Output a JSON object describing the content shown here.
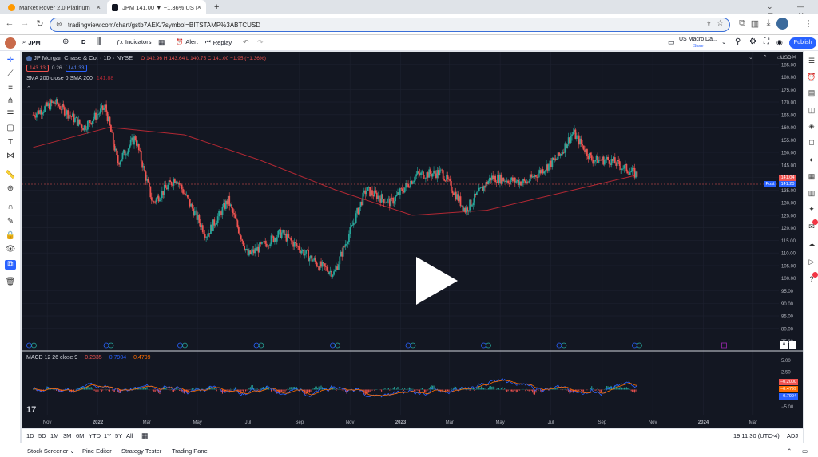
{
  "browser": {
    "tabs": [
      {
        "label": "Market Rover 2.0 Platinum"
      },
      {
        "label": "JPM 141.00 ▼ −1.36% US M..."
      }
    ],
    "url": "tradingview.com/chart/gstb7AEK/?symbol=BITSTAMP%3ABTCUSD"
  },
  "toolbar": {
    "symbol": "JPM",
    "interval": "D",
    "indicators_label": "Indicators",
    "alert_label": "Alert",
    "replay_label": "Replay",
    "layout_name": "US Macro Da...",
    "layout_status": "Save",
    "publish_label": "Publish"
  },
  "legend": {
    "title": "JP Morgan Chase & Co. · 1D · NYSE",
    "ohlc": "O 142.96 H 143.64 L 140.75 C 141.00 −1.95 (−1.36%)",
    "bid": "143.13",
    "spread": "0.26",
    "ask": "141.33",
    "sma_label": "SMA 200 close 0 SMA 200",
    "sma_value": "141.88",
    "macd_label": "MACD 12 26 close 9",
    "macd_v1": "−0.2835",
    "macd_v2": "−0.7904",
    "macd_v3": "−0.4799"
  },
  "price_axis": {
    "currency": "USD",
    "ticks": [
      "185.00",
      "180.00",
      "175.00",
      "170.00",
      "165.00",
      "160.00",
      "155.00",
      "150.00",
      "145.00",
      "140.00",
      "135.00",
      "130.00",
      "125.00",
      "120.00",
      "115.00",
      "110.00",
      "105.00",
      "100.00",
      "95.00",
      "90.00",
      "85.00",
      "80.00",
      "75.00"
    ],
    "last_price_red": "141.04",
    "post_label": "Post",
    "post_price": "141.20",
    "auto_btn": "A",
    "log_btn": "L"
  },
  "macd_axis": {
    "ticks": [
      "5.00",
      "2.50",
      "0.00",
      "−2.50",
      "−5.00"
    ],
    "badges": [
      "−0.2000",
      "−0.4799",
      "−0.7904"
    ]
  },
  "time_axis": {
    "labels": [
      "Nov",
      "2022",
      "Mar",
      "May",
      "Jul",
      "Sep",
      "Nov",
      "2023",
      "Mar",
      "May",
      "Jul",
      "Sep",
      "Nov",
      "2024",
      "Mar"
    ]
  },
  "timeframes": {
    "items": [
      "1D",
      "5D",
      "1M",
      "3M",
      "6M",
      "YTD",
      "1Y",
      "5Y",
      "All"
    ],
    "clock": "19:11:30 (UTC-4)",
    "adj": "ADJ"
  },
  "bottom_panel": {
    "items": [
      "Stock Screener",
      "Pine Editor",
      "Strategy Tester",
      "Trading Panel"
    ]
  },
  "colors": {
    "up": "#26a69a",
    "down": "#ef5350",
    "sma": "#b22833",
    "macd": "#2962ff",
    "signal": "#ff6d00",
    "bg": "#131722"
  },
  "chart_data": {
    "type": "candlestick",
    "title": "JP Morgan Chase & Co. · 1D · NYSE",
    "ylim": [
      72,
      190
    ],
    "x_range": [
      "2021-10",
      "2024-04"
    ],
    "price_path_approx": [
      {
        "x": "2021-10-15",
        "y": 165
      },
      {
        "x": "2021-11-10",
        "y": 170
      },
      {
        "x": "2021-12-15",
        "y": 160
      },
      {
        "x": "2022-01-10",
        "y": 168
      },
      {
        "x": "2022-01-25",
        "y": 146
      },
      {
        "x": "2022-02-15",
        "y": 156
      },
      {
        "x": "2022-03-08",
        "y": 130
      },
      {
        "x": "2022-04-05",
        "y": 140
      },
      {
        "x": "2022-05-12",
        "y": 117
      },
      {
        "x": "2022-06-07",
        "y": 131
      },
      {
        "x": "2022-07-01",
        "y": 109
      },
      {
        "x": "2022-08-10",
        "y": 118
      },
      {
        "x": "2022-09-25",
        "y": 105
      },
      {
        "x": "2022-10-13",
        "y": 102
      },
      {
        "x": "2022-11-20",
        "y": 135
      },
      {
        "x": "2022-12-20",
        "y": 130
      },
      {
        "x": "2023-01-20",
        "y": 141
      },
      {
        "x": "2023-02-20",
        "y": 142
      },
      {
        "x": "2023-03-20",
        "y": 127
      },
      {
        "x": "2023-04-20",
        "y": 140
      },
      {
        "x": "2023-06-01",
        "y": 138
      },
      {
        "x": "2023-07-10",
        "y": 148
      },
      {
        "x": "2023-07-28",
        "y": 158
      },
      {
        "x": "2023-08-20",
        "y": 147
      },
      {
        "x": "2023-09-10",
        "y": 147
      },
      {
        "x": "2023-10-13",
        "y": 141
      }
    ],
    "sma200_path_approx": [
      {
        "x": "2021-10-15",
        "y": 152
      },
      {
        "x": "2022-01-15",
        "y": 160
      },
      {
        "x": "2022-04-15",
        "y": 157
      },
      {
        "x": "2022-07-15",
        "y": 147
      },
      {
        "x": "2022-10-15",
        "y": 135
      },
      {
        "x": "2023-01-15",
        "y": 125
      },
      {
        "x": "2023-04-15",
        "y": 127
      },
      {
        "x": "2023-07-15",
        "y": 134
      },
      {
        "x": "2023-10-13",
        "y": 141
      }
    ]
  }
}
